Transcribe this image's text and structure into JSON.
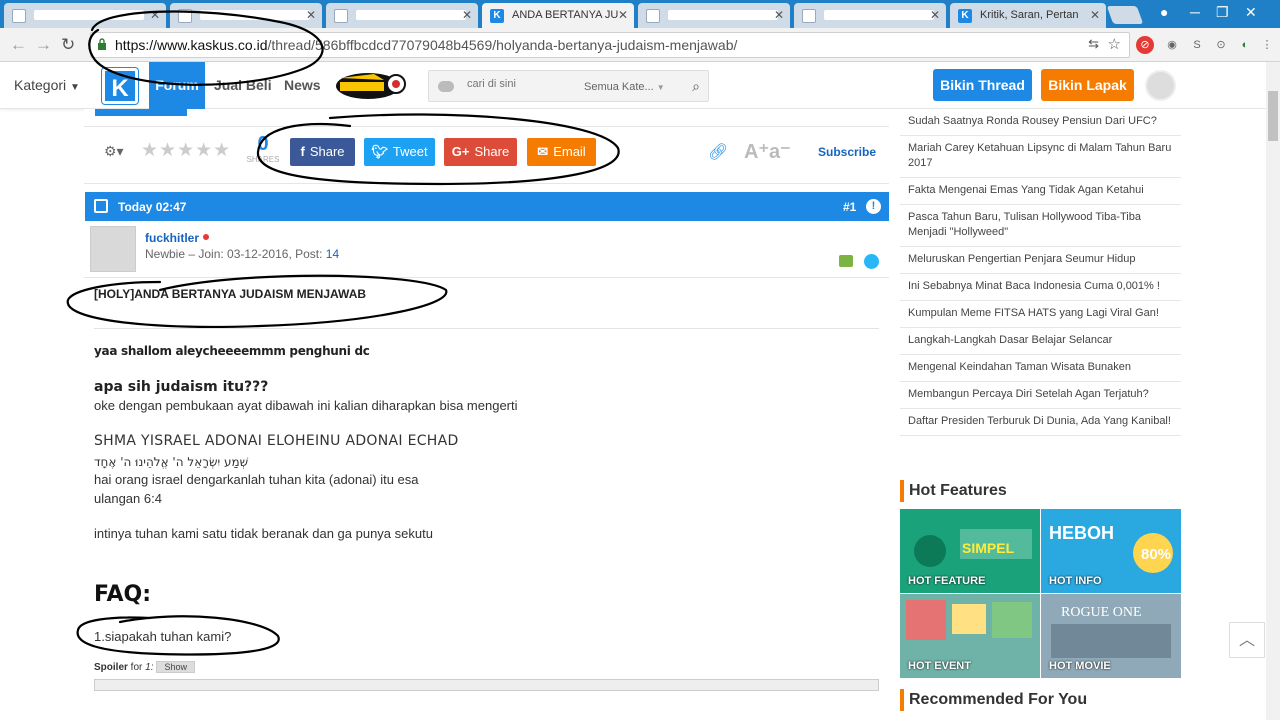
{
  "browser": {
    "tabs": [
      {
        "label": "",
        "active": false
      },
      {
        "label": "",
        "active": false
      },
      {
        "label": "",
        "active": false
      },
      {
        "label": "ANDA BERTANYA JU",
        "active": true
      },
      {
        "label": "",
        "active": false
      },
      {
        "label": "",
        "active": false
      },
      {
        "label": "Kritik, Saran, Pertan",
        "active": false
      }
    ],
    "url_host": "https://www.kaskus.co.id",
    "url_path": "/thread/586bffbcdcd77079048b4569/holyanda-bertanya-judaism-menjawab/"
  },
  "header": {
    "kategori": "Kategori",
    "logo": "K",
    "nav": [
      "Forum",
      "Jual Beli",
      "News"
    ],
    "search_placeholder": "cari di sini",
    "search_category": "Semua Kate...",
    "bikin_thread": "Bikin Thread",
    "bikin_lapak": "Bikin Lapak"
  },
  "sharebar": {
    "share_count": "0",
    "shares_label": "SHARES",
    "facebook": "Share",
    "twitter": "Tweet",
    "gplus": "Share",
    "email": "Email",
    "subscribe": "Subscribe",
    "fontsize": "A⁺a⁻"
  },
  "post": {
    "time": "Today 02:47",
    "number": "#1",
    "username": "fuckhitler",
    "rank": "Newbie",
    "join_label": "Join: 03-12-2016, Post: ",
    "post_count": "14",
    "title": "[HOLY]ANDA BERTANYA JUDAISM MENJAWAB",
    "greeting": "yaa shallom aleycheeeemmm penghuni dc",
    "question1": "apa sih judaism itu???",
    "line1": "oke dengan pembukaan ayat dibawah ini kalian diharapkan bisa mengerti",
    "shma": "SHMA YISRAEL ADONAI ELOHEINU ADONAI ECHAD",
    "hebrew": "שְׁמַע יִשְׂרָאֵל ה' אֱלֹהֵינוּ ה' אֶחָד",
    "line2": "hai orang israel dengarkanlah tuhan kita (adonai) itu esa",
    "line3": "ulangan 6:4",
    "line4": "intinya tuhan kami satu tidak beranak dan ga punya sekutu",
    "faq": "FAQ:",
    "faq_q1": "1.siapakah tuhan kami?",
    "spoiler_label": "Spoiler",
    "spoiler_for": " for ",
    "spoiler_num": "1:",
    "spoiler_show": "Show"
  },
  "sidebar": {
    "related": [
      "Sudah Saatnya Ronda Rousey Pensiun Dari UFC?",
      "Mariah Carey Ketahuan Lipsync di Malam Tahun Baru 2017",
      "Fakta Mengenai Emas Yang Tidak Agan Ketahui",
      "Pasca Tahun Baru, Tulisan Hollywood Tiba-Tiba Menjadi \"Hollyweed\"",
      "Meluruskan Pengertian Penjara Seumur Hidup",
      "Ini Sebabnya Minat Baca Indonesia Cuma 0,001% !",
      "Kumpulan Meme FITSA HATS yang Lagi Viral Gan!",
      "Langkah-Langkah Dasar Belajar Selancar",
      "Mengenal Keindahan Taman Wisata Bunaken",
      "Membangun Percaya Diri Setelah Agan Terjatuh?",
      "Daftar Presiden Terburuk Di Dunia, Ada Yang Kanibal!"
    ],
    "hot_features_title": "Hot Features",
    "hot": [
      {
        "label": "HOT FEATURE",
        "color": "#1aa37a"
      },
      {
        "label": "HOT INFO",
        "color": "#2aa8e0"
      },
      {
        "label": "HOT EVENT",
        "color": "#6fb3a8"
      },
      {
        "label": "HOT MOVIE",
        "color": "#8fa9b8"
      }
    ],
    "recommended_title": "Recommended For You"
  },
  "colors": {
    "kaskus_blue": "#1e88e5",
    "orange": "#f57c00",
    "facebook": "#3b5998",
    "twitter": "#1da1f2",
    "gplus": "#dd4b39",
    "email": "#f57c00"
  }
}
